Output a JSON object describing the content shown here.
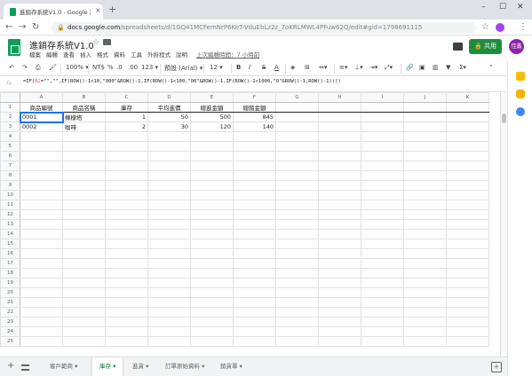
{
  "browser": {
    "tab_title": "進銷存系統V1.0 - Google 試算表",
    "tab_close": "×",
    "new_tab": "+",
    "min": "–",
    "max": "☐",
    "close": "✕",
    "url_host": "docs.google.com",
    "url_path": "/spreadsheets/d/1GQ41MCFemNrP6KeT-VduEbLz2z_7oKRLMWL4PFuw62Q/edit#gid=1798691115"
  },
  "sheets": {
    "doc_title": "進銷存系統V1.0",
    "menu": [
      "檔案",
      "編輯",
      "查看",
      "插入",
      "格式",
      "資料",
      "工具",
      "外掛程式",
      "說明"
    ],
    "last_edit": "上次編輯時間：7 小時前",
    "share_label": "共用",
    "avatar_label": "佳鑫",
    "colors": {
      "green": "#0f9d58",
      "share": "#1e8e3e",
      "active_tab": "#188038",
      "selection": "#1a73e8"
    }
  },
  "toolbar": {
    "zoom": "100%",
    "currency": "NT$",
    "percent": "%",
    "dec_down": ".0",
    "dec_up": ".00",
    "more_formats": "123",
    "font": "預設 (Arial)",
    "size": "12",
    "bold": "B",
    "italic": "I",
    "strike": "S",
    "text_color": "A"
  },
  "formula_bar": {
    "fx": "fx",
    "p1": "=IF(",
    "p2": "B2",
    "p3": "=\"\",\"\",IF(ROW()-1<10,\"000\"&ROW()-1,IF(ROW()-1<100,\"00\"&ROW()-1,IF(ROW()-1<1000,\"0\"&ROW()-1,ROW()-1))))"
  },
  "grid": {
    "columns": [
      "A",
      "B",
      "C",
      "D",
      "E",
      "F",
      "G",
      "H",
      "I",
      "J",
      "K"
    ],
    "row_count": 25,
    "rows": [
      [
        "商品編號",
        "商品名稱",
        "庫存",
        "平均進價",
        "總進金額",
        "總銷金額"
      ],
      [
        "0001",
        "檸檬塔",
        "1",
        "50",
        "500",
        "845"
      ],
      [
        "0002",
        "咖啡",
        "2",
        "30",
        "120",
        "140"
      ]
    ]
  },
  "sheet_tabs": {
    "add": "+",
    "tabs": [
      "客戶範商",
      "庫存",
      "進貨",
      "訂單原始資料",
      "銷貨單"
    ],
    "active_index": 1
  },
  "side_panel": {
    "icons": [
      "calendar-icon",
      "keep-icon",
      "tasks-icon"
    ]
  }
}
